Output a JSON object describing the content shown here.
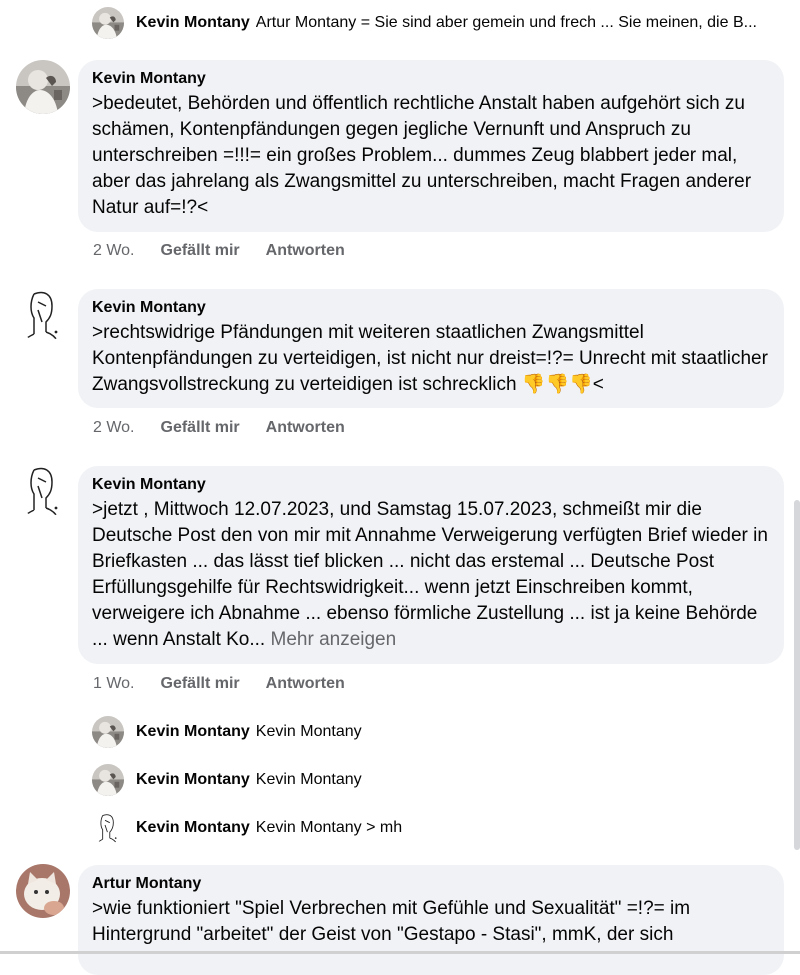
{
  "replies_top": [
    {
      "name": "Kevin Montany",
      "text": "Artur Montany = Sie sind aber gemein und frech ... Sie meinen, die B..."
    }
  ],
  "comments": [
    {
      "author": "Kevin Montany",
      "body": ">bedeutet, Behörden und öffentlich rechtliche Anstalt haben aufgehört sich zu schämen, Kontenpfändungen gegen jegliche Vernunft und Anspruch zu unterschreiben =!!!= ein großes Problem... dummes Zeug blabbert jeder mal, aber das jahrelang als Zwangsmittel zu unterschreiben,  macht Fragen anderer Natur auf=!?<",
      "time": "2 Wo.",
      "like": "Gefällt mir",
      "reply": "Antworten"
    },
    {
      "author": "Kevin Montany",
      "body": ">rechtswidrige Pfändungen mit weiteren staatlichen Zwangsmittel Kontenpfändungen zu verteidigen, ist nicht nur dreist=!?= Unrecht mit staatlicher Zwangsvollstreckung zu verteidigen ist schrecklich ",
      "emoji": "👎👎👎<",
      "time": "2 Wo.",
      "like": "Gefällt mir",
      "reply": "Antworten"
    },
    {
      "author": "Kevin Montany",
      "body": ">jetzt , Mittwoch 12.07.2023, und Samstag 15.07.2023, schmeißt mir die Deutsche Post den von mir mit Annahme Verweigerung verfügten Brief wieder in Briefkasten ... das lässt tief blicken ... nicht das erstemal ... Deutsche Post Erfüllungsgehilfe für Rechtswidrigkeit... wenn jetzt Einschreiben kommt, verweigere ich Abnahme ... ebenso förmliche Zustellung ... ist ja keine Behörde ... wenn Anstalt Ko...",
      "more": " Mehr anzeigen",
      "time": "1 Wo.",
      "like": "Gefällt mir",
      "reply": "Antworten"
    },
    {
      "author": "Artur Montany",
      "body": ">wie funktioniert \"Spiel Verbrechen mit Gefühle und Sexualität\" =!?= im Hintergrund \"arbeitet\" der Geist von \"Gestapo - Stasi\", mmK, der sich"
    }
  ],
  "replies_mid": [
    {
      "name": "Kevin Montany",
      "text": "Kevin Montany"
    },
    {
      "name": "Kevin Montany",
      "text": "Kevin Montany"
    },
    {
      "name": "Kevin Montany",
      "text": "Kevin Montany > mh"
    }
  ],
  "icons": {
    "avatar_photo": "avatar-photo-icon",
    "avatar_sketch": "avatar-sketch-icon",
    "avatar_cat": "avatar-cat-icon",
    "thumbs_down": "thumbs-down-icon"
  }
}
